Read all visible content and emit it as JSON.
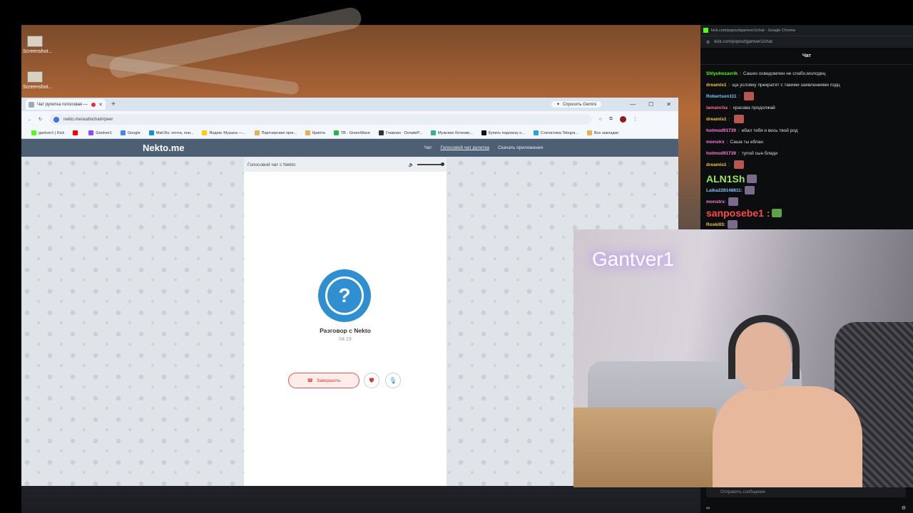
{
  "desktop": {
    "icons": [
      {
        "label": "Screenshot..."
      },
      {
        "label": "Screenshot..."
      }
    ]
  },
  "browser": {
    "tab_title": "Чат рулетка голосовая —",
    "new_tab": "+",
    "gemini_label": "Спросить Gemini",
    "url": "nekto.me/audiochat#/peer",
    "bookmarks": [
      {
        "label": "gantver1 | Kick",
        "color": "#53fc18"
      },
      {
        "label": "",
        "color": "#ff0000"
      },
      {
        "label": "Gantver1",
        "color": "#9146ff"
      },
      {
        "label": "Google",
        "color": "#4285f4"
      },
      {
        "label": "Mail.Ru: почта, пои...",
        "color": "#168de2"
      },
      {
        "label": "Яндекс Музыка —...",
        "color": "#ffcc00"
      },
      {
        "label": "Партнерские прог...",
        "color": "#e0b252"
      },
      {
        "label": "Крипта",
        "color": "#e0b252"
      },
      {
        "label": "TB - GreenWave",
        "color": "#2bb24c"
      },
      {
        "label": "Главная · DonateP...",
        "color": "#333333"
      },
      {
        "label": "Мужские ботинки...",
        "color": "#36b37e"
      },
      {
        "label": "Купить подписку н...",
        "color": "#111111"
      },
      {
        "label": "Статистика Telegra...",
        "color": "#2aa3d9"
      },
      {
        "label": "Все закладки",
        "color": "#e0b252"
      }
    ],
    "more_label": "»"
  },
  "nekto": {
    "logo": "Nekto.me",
    "nav": [
      "Чат",
      "Голосовой чат рулетка",
      "Скачать приложения"
    ],
    "panel_title": "Голосовой чат с Nekto",
    "avatar_glyph": "?",
    "call_title": "Разговор с Nekto",
    "call_time": "04:19",
    "end_button": "Завершить"
  },
  "chat": {
    "window_title": "kick.com/popout/gantver1/chat - Google Chrome",
    "url": "kick.com/popout/gantver1/chat",
    "header": "Чат",
    "messages": [
      {
        "user": "Shlyuhozavrik",
        "text": "Сашко осведомлен не слабо,молодец",
        "color": "#53fc18"
      },
      {
        "user": "dreamis1",
        "text": "ща условку прекратят с такими заявлениями пздц",
        "color": "#f5c542"
      },
      {
        "user": "Robertson111",
        "text": "",
        "color": "#7ac7ff"
      },
      {
        "user": "lamancha",
        "text": "красава продолжай",
        "color": "#ff6fa5"
      },
      {
        "user": "dreamis1",
        "text": "",
        "color": "#f5c542"
      },
      {
        "user": "hotmod91739",
        "text": "ебал тебя и весь твой род",
        "color": "#ff7ad9"
      },
      {
        "user": "monstrx",
        "text": "Саша ты еблан",
        "color": "#ff7ad9"
      },
      {
        "user": "hotmod91739",
        "text": "тупой сын бляди",
        "color": "#ff7ad9"
      },
      {
        "user": "dreamis1",
        "text": "",
        "color": "#f5c542"
      }
    ],
    "big_lines": [
      {
        "text": "ALN1Sh",
        "color": "#9be564"
      },
      {
        "text": "Laika228148811:",
        "color": "#8ac7ff"
      },
      {
        "text": "monstrx:",
        "color": "#ff7ad9"
      },
      {
        "text": "sanposebe1 :",
        "color": "#ff4a4a"
      },
      {
        "text": "Roskill3:",
        "color": "#f5c542"
      }
    ],
    "input_placeholder": "Отправить сообщение",
    "footer_left": "∞"
  },
  "webcam": {
    "neon_sign": "Gantver1"
  }
}
